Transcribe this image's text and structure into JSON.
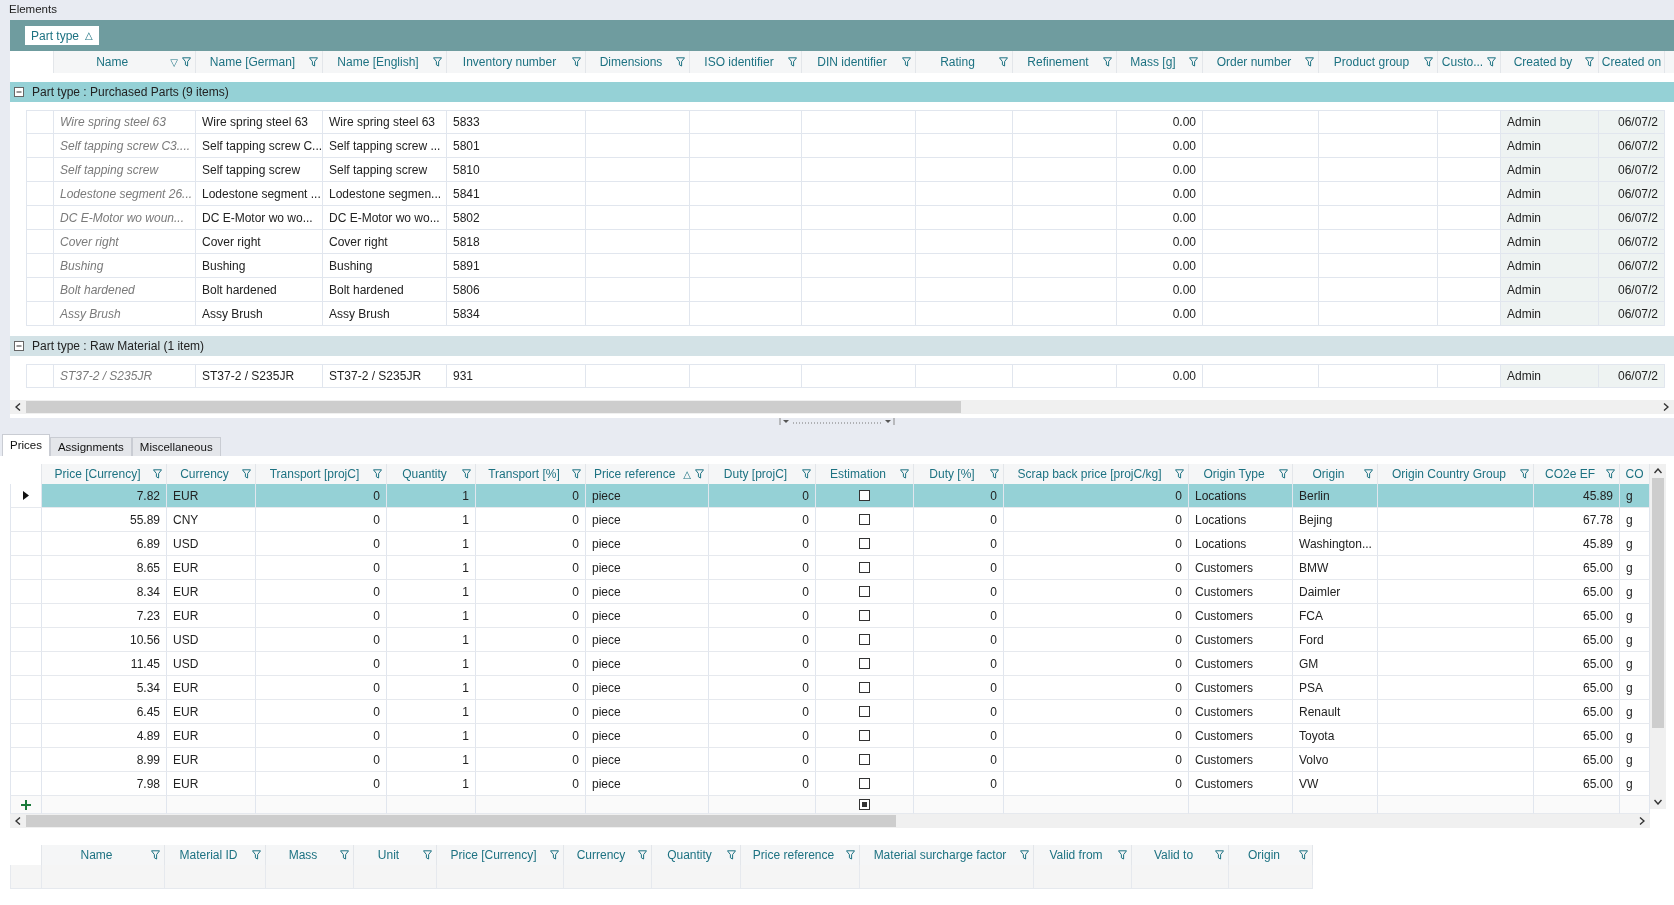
{
  "panel_title": "Elements",
  "elements_grid": {
    "group_by": {
      "label": "Part type",
      "sort_icon": "△"
    },
    "columns": [
      {
        "label": "Name",
        "kind": "italic",
        "sort_icon": "▽",
        "filter": true
      },
      {
        "label": "Name [German]",
        "kind": "text",
        "filter": true
      },
      {
        "label": "Name [English]",
        "kind": "text",
        "filter": true
      },
      {
        "label": "Inventory number",
        "kind": "text",
        "filter": true
      },
      {
        "label": "Dimensions",
        "kind": "text",
        "filter": true
      },
      {
        "label": "ISO identifier",
        "kind": "text",
        "filter": true
      },
      {
        "label": "DIN identifier",
        "kind": "text",
        "filter": true
      },
      {
        "label": "Rating",
        "kind": "text",
        "filter": true
      },
      {
        "label": "Refinement",
        "kind": "text",
        "filter": true
      },
      {
        "label": "Mass [g]",
        "kind": "number",
        "filter": true
      },
      {
        "label": "Order number",
        "kind": "text",
        "filter": true
      },
      {
        "label": "Product group",
        "kind": "text",
        "filter": true
      },
      {
        "label": "Custo...",
        "kind": "text",
        "filter": true
      },
      {
        "label": "Created by",
        "kind": "readonly",
        "filter": true
      },
      {
        "label": "Created on",
        "kind": "readonly-number",
        "filter": false
      }
    ],
    "groups": [
      {
        "label": "Part type : Purchased Parts (9 items)",
        "expanded": true,
        "selected": true,
        "rows": [
          {
            "cells": [
              "Wire spring steel 63",
              "Wire spring steel 63",
              "Wire spring steel 63",
              "5833",
              null,
              null,
              null,
              null,
              null,
              "0.00",
              null,
              null,
              null,
              "Admin",
              "06/07/2"
            ]
          },
          {
            "cells": [
              "Self tapping screw C3....",
              "Self tapping screw C...",
              "Self tapping screw ...",
              "5801",
              null,
              null,
              null,
              null,
              null,
              "0.00",
              null,
              null,
              null,
              "Admin",
              "06/07/2"
            ]
          },
          {
            "cells": [
              "Self tapping screw",
              "Self tapping screw",
              "Self tapping screw",
              "5810",
              null,
              null,
              null,
              null,
              null,
              "0.00",
              null,
              null,
              null,
              "Admin",
              "06/07/2"
            ]
          },
          {
            "cells": [
              "Lodestone segment 26...",
              "Lodestone segment ...",
              "Lodestone segmen...",
              "5841",
              null,
              null,
              null,
              null,
              null,
              "0.00",
              null,
              null,
              null,
              "Admin",
              "06/07/2"
            ]
          },
          {
            "cells": [
              "DC E-Motor wo woun...",
              "DC E-Motor wo wo...",
              "DC E-Motor wo wo...",
              "5802",
              null,
              null,
              null,
              null,
              null,
              "0.00",
              null,
              null,
              null,
              "Admin",
              "06/07/2"
            ]
          },
          {
            "cells": [
              "Cover right",
              "Cover right",
              "Cover right",
              "5818",
              null,
              null,
              null,
              null,
              null,
              "0.00",
              null,
              null,
              null,
              "Admin",
              "06/07/2"
            ]
          },
          {
            "cells": [
              "Bushing",
              "Bushing",
              "Bushing",
              "5891",
              null,
              null,
              null,
              null,
              null,
              "0.00",
              null,
              null,
              null,
              "Admin",
              "06/07/2"
            ]
          },
          {
            "cells": [
              "Bolt hardened",
              "Bolt hardened",
              "Bolt hardened",
              "5806",
              null,
              null,
              null,
              null,
              null,
              "0.00",
              null,
              null,
              null,
              "Admin",
              "06/07/2"
            ]
          },
          {
            "cells": [
              "Assy Brush",
              "Assy Brush",
              "Assy Brush",
              "5834",
              null,
              null,
              null,
              null,
              null,
              "0.00",
              null,
              null,
              null,
              "Admin",
              "06/07/2"
            ]
          }
        ]
      },
      {
        "label": "Part type : Raw Material (1 item)",
        "expanded": true,
        "selected": false,
        "rows": [
          {
            "cells": [
              "ST37-2 / S235JR",
              "ST37-2 / S235JR",
              "ST37-2 / S235JR",
              "931",
              null,
              null,
              null,
              null,
              null,
              "0.00",
              null,
              null,
              null,
              "Admin",
              "06/07/2"
            ]
          }
        ]
      }
    ]
  },
  "tabs": [
    {
      "label": "Prices",
      "selected": true
    },
    {
      "label": "Assignments",
      "selected": false
    },
    {
      "label": "Miscellaneous",
      "selected": false
    }
  ],
  "prices_grid": {
    "columns": [
      {
        "label": "Price [Currency]",
        "kind": "number",
        "filter": true
      },
      {
        "label": "Currency",
        "kind": "text",
        "filter": true
      },
      {
        "label": "Transport [projC]",
        "kind": "number",
        "filter": true
      },
      {
        "label": "Quantity",
        "kind": "number",
        "filter": true
      },
      {
        "label": "Transport [%]",
        "kind": "number",
        "filter": true
      },
      {
        "label": "Price reference",
        "kind": "text",
        "sort_icon": "△",
        "filter": true
      },
      {
        "label": "Duty [projC]",
        "kind": "number",
        "filter": true
      },
      {
        "label": "Estimation",
        "kind": "check",
        "filter": true
      },
      {
        "label": "Duty [%]",
        "kind": "number",
        "filter": true
      },
      {
        "label": "Scrap back price [projC/kg]",
        "kind": "number",
        "filter": true
      },
      {
        "label": "Origin Type",
        "kind": "text",
        "filter": true
      },
      {
        "label": "Origin",
        "kind": "text",
        "filter": true
      },
      {
        "label": "Origin Country Group",
        "kind": "text",
        "filter": true
      },
      {
        "label": "CO2e EF",
        "kind": "number",
        "filter": true
      },
      {
        "label": "CO",
        "kind": "text",
        "filter": false
      }
    ],
    "rows": [
      {
        "selected": true,
        "cells": [
          "7.82",
          "EUR",
          "0",
          "1",
          "0",
          "piece",
          "0",
          false,
          "0",
          "0",
          "Locations",
          "Berlin",
          null,
          "45.89",
          "g"
        ]
      },
      {
        "selected": false,
        "cells": [
          "55.89",
          "CNY",
          "0",
          "1",
          "0",
          "piece",
          "0",
          false,
          "0",
          "0",
          "Locations",
          "Bejing",
          null,
          "67.78",
          "g"
        ]
      },
      {
        "selected": false,
        "cells": [
          "6.89",
          "USD",
          "0",
          "1",
          "0",
          "piece",
          "0",
          false,
          "0",
          "0",
          "Locations",
          "Washington...",
          null,
          "45.89",
          "g"
        ]
      },
      {
        "selected": false,
        "cells": [
          "8.65",
          "EUR",
          "0",
          "1",
          "0",
          "piece",
          "0",
          false,
          "0",
          "0",
          "Customers",
          "BMW",
          null,
          "65.00",
          "g"
        ]
      },
      {
        "selected": false,
        "cells": [
          "8.34",
          "EUR",
          "0",
          "1",
          "0",
          "piece",
          "0",
          false,
          "0",
          "0",
          "Customers",
          "Daimler",
          null,
          "65.00",
          "g"
        ]
      },
      {
        "selected": false,
        "cells": [
          "7.23",
          "EUR",
          "0",
          "1",
          "0",
          "piece",
          "0",
          false,
          "0",
          "0",
          "Customers",
          "FCA",
          null,
          "65.00",
          "g"
        ]
      },
      {
        "selected": false,
        "cells": [
          "10.56",
          "USD",
          "0",
          "1",
          "0",
          "piece",
          "0",
          false,
          "0",
          "0",
          "Customers",
          "Ford",
          null,
          "65.00",
          "g"
        ]
      },
      {
        "selected": false,
        "cells": [
          "11.45",
          "USD",
          "0",
          "1",
          "0",
          "piece",
          "0",
          false,
          "0",
          "0",
          "Customers",
          "GM",
          null,
          "65.00",
          "g"
        ]
      },
      {
        "selected": false,
        "cells": [
          "5.34",
          "EUR",
          "0",
          "1",
          "0",
          "piece",
          "0",
          false,
          "0",
          "0",
          "Customers",
          "PSA",
          null,
          "65.00",
          "g"
        ]
      },
      {
        "selected": false,
        "cells": [
          "6.45",
          "EUR",
          "0",
          "1",
          "0",
          "piece",
          "0",
          false,
          "0",
          "0",
          "Customers",
          "Renault",
          null,
          "65.00",
          "g"
        ]
      },
      {
        "selected": false,
        "cells": [
          "4.89",
          "EUR",
          "0",
          "1",
          "0",
          "piece",
          "0",
          false,
          "0",
          "0",
          "Customers",
          "Toyota",
          null,
          "65.00",
          "g"
        ]
      },
      {
        "selected": false,
        "cells": [
          "8.99",
          "EUR",
          "0",
          "1",
          "0",
          "piece",
          "0",
          false,
          "0",
          "0",
          "Customers",
          "Volvo",
          null,
          "65.00",
          "g"
        ]
      },
      {
        "selected": false,
        "cells": [
          "7.98",
          "EUR",
          "0",
          "1",
          "0",
          "piece",
          "0",
          false,
          "0",
          "0",
          "Customers",
          "VW",
          null,
          "65.00",
          "g"
        ]
      }
    ],
    "new_row": {
      "estimation_indeterminate": true
    }
  },
  "materials_grid": {
    "columns": [
      {
        "label": "Name",
        "filter": true
      },
      {
        "label": "Material ID",
        "filter": true
      },
      {
        "label": "Mass",
        "filter": true
      },
      {
        "label": "Unit",
        "filter": true
      },
      {
        "label": "Price [Currency]",
        "filter": true
      },
      {
        "label": "Currency",
        "filter": true
      },
      {
        "label": "Quantity",
        "filter": true
      },
      {
        "label": "Price reference",
        "filter": true
      },
      {
        "label": "Material surcharge factor",
        "filter": true
      },
      {
        "label": "Valid from",
        "filter": true
      },
      {
        "label": "Valid to",
        "filter": true
      },
      {
        "label": "Origin",
        "filter": true
      }
    ]
  }
}
